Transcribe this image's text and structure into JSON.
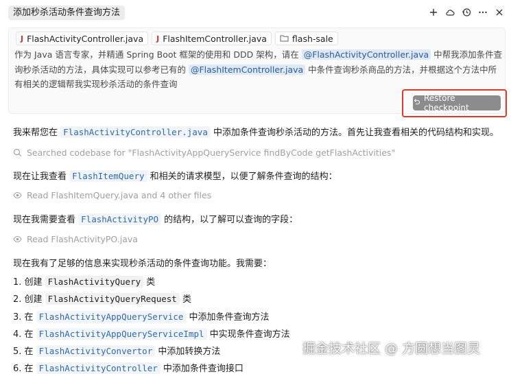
{
  "header": {
    "title": "添加秒杀活动条件查询方法",
    "actions": [
      "plus-icon",
      "cloud-icon",
      "history-icon",
      "more-icon",
      "close-icon"
    ]
  },
  "prompt": {
    "chips": [
      {
        "icon": "java-file-icon",
        "label": "FlashActivityController.java"
      },
      {
        "icon": "java-file-icon",
        "label": "FlashItemController.java"
      },
      {
        "icon": "folder-icon",
        "label": "flash-sale"
      }
    ],
    "text_a": "作为 Java 语言专家，并精通 Spring Boot 框架的使用和 DDD 架构，请在 ",
    "mention_1": "@FlashActivityController.java",
    "text_b": " 中帮我添加条件查询秒杀活动的方法，具体实现可以参考已有的 ",
    "mention_2": "@FlashItemController.java",
    "text_c": " 中条件查询秒杀商品的方法，并根据这个方法中所有相关的逻辑帮我实现秒杀活动的条件查询",
    "restore_label": "Restore checkpoint"
  },
  "messages": {
    "m1_a": "我来帮您在 ",
    "m1_code": "FlashActivityController.java",
    "m1_b": " 中添加条件查询秒杀活动的方法。首先让我查看相关的代码结构和实现。",
    "tool1": "Searched codebase for \"FlashActivityAppQueryService findByCode getFlashActivities\"",
    "m2_a": "现在让我查看 ",
    "m2_code": "FlashItemQuery",
    "m2_b": " 和相关的请求模型，以便了解条件查询的结构：",
    "tool2": "Read FlashItemQuery.java and 4 other files",
    "m3_a": "现在我需要查看 ",
    "m3_code": "FlashActivityPO",
    "m3_b": " 的结构，以了解可以查询的字段：",
    "tool3": "Read FlashActivityPO.java",
    "m4": "现在我有了足够的信息来实现秒杀活动的条件查询功能。我需要：",
    "steps": [
      {
        "num": "1. 创建 ",
        "code": "FlashActivityQuery",
        "rest": " 类"
      },
      {
        "num": "2. 创建 ",
        "code": "FlashActivityQueryRequest",
        "rest": " 类"
      },
      {
        "num": "3. 在 ",
        "code": "FlashActivityAppQueryService",
        "rest": " 中添加条件查询方法"
      },
      {
        "num": "4. 在 ",
        "code": "FlashActivityAppQueryServiceImpl",
        "rest": " 中实现条件查询方法"
      },
      {
        "num": "5. 在 ",
        "code": "FlashActivityConvertor",
        "rest": " 中添加转换方法"
      },
      {
        "num": "6. 在 ",
        "code": "FlashActivityController",
        "rest": " 中添加条件查询接口"
      }
    ]
  },
  "watermark": "掘金技术社区 @ 方圆想当图灵"
}
